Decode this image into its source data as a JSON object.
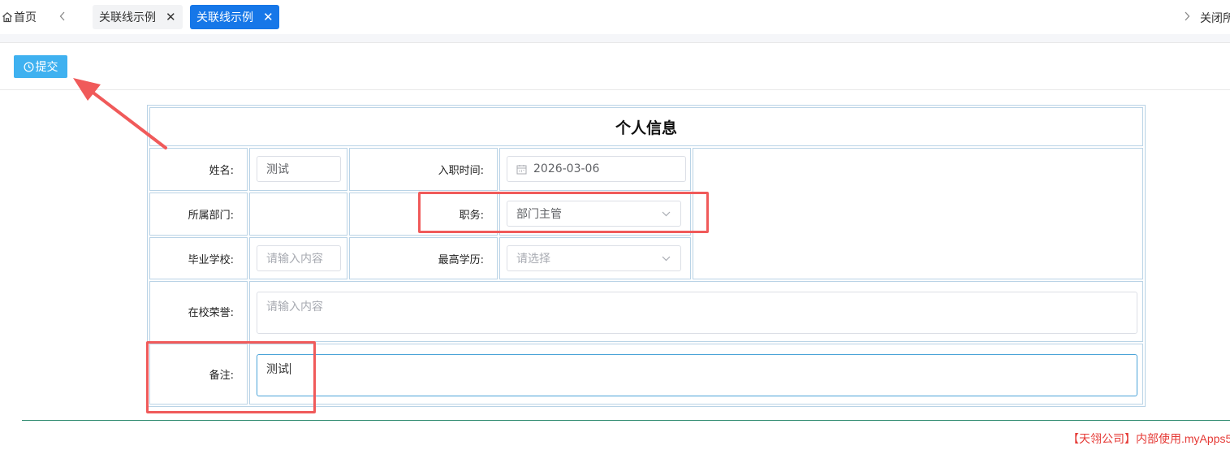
{
  "tabbar": {
    "home_label": "首页",
    "tabs": [
      {
        "label": "关联线示例",
        "active": false
      },
      {
        "label": "关联线示例",
        "active": true
      }
    ],
    "close_all_label": "关闭所",
    "active_color": "#1677e8"
  },
  "toolbar": {
    "submit_label": "提交",
    "submit_color": "#3fb1f0"
  },
  "form": {
    "title": "个人信息",
    "fields": {
      "name": {
        "label": "姓名:",
        "value": "测试"
      },
      "entry_date": {
        "label": "入职时间:",
        "value": "2026-03-06",
        "icon": "calendar-icon"
      },
      "department": {
        "label": "所属部门:",
        "value": ""
      },
      "position": {
        "label": "职务:",
        "value": "部门主管"
      },
      "school": {
        "label": "毕业学校:",
        "placeholder": "请输入内容"
      },
      "education": {
        "label": "最高学历:",
        "placeholder": "请选择"
      },
      "honors": {
        "label": "在校荣誉:",
        "placeholder": "请输入内容"
      },
      "remark": {
        "label": "备注:",
        "value": "测试"
      }
    }
  },
  "footer": {
    "text": "【天翎公司】内部使用.myApps5"
  },
  "annotation_color": "#f05a5a"
}
